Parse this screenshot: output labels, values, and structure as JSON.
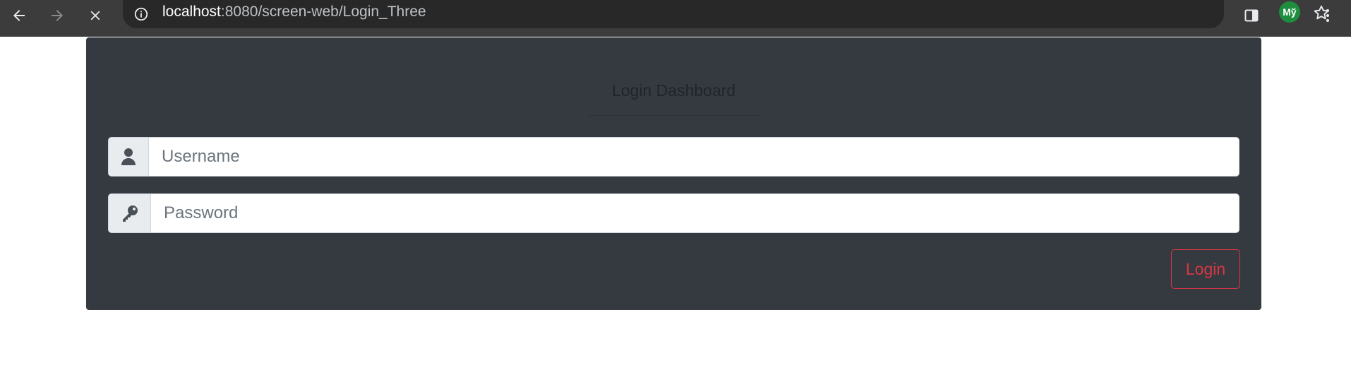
{
  "browser": {
    "url_host": "localhost",
    "url_path": ":8080/screen-web/Login_Three",
    "profile_initials": "Mў",
    "icons": {
      "back": "arrow-left-icon",
      "forward": "arrow-right-icon",
      "stop": "close-icon",
      "info": "info-icon",
      "bookmark": "star-icon",
      "side_panel": "side-panel-icon",
      "menu": "kebab-menu-icon"
    }
  },
  "login": {
    "title": "Login Dashboard",
    "username_placeholder": "Username",
    "password_placeholder": "Password",
    "submit_label": "Login",
    "icons": {
      "username": "user-icon",
      "password": "key-icon"
    }
  },
  "colors": {
    "card_bg": "#343a40",
    "accent_danger": "#dc3545",
    "toolbar_bg": "#3c3c3c",
    "avatar_bg": "#1e8e3e"
  }
}
